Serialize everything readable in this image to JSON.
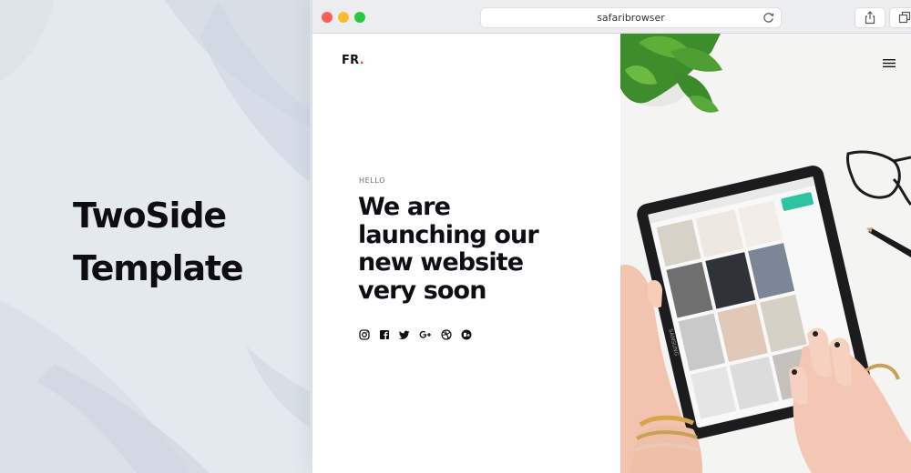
{
  "promo": {
    "title_line1": "TwoSide",
    "title_line2": "Template"
  },
  "browser": {
    "address": "safaribrowser"
  },
  "site": {
    "logo_text": "FR",
    "logo_dot": ".",
    "eyebrow": "HELLO",
    "headline": [
      "We are",
      "launching our",
      "new website",
      "very soon"
    ],
    "socials": [
      "instagram-icon",
      "facebook-icon",
      "twitter-icon",
      "google-plus-icon",
      "dribbble-icon",
      "behance-icon"
    ]
  },
  "hero_image": {
    "device_brand": "SAMSUNG"
  },
  "colors": {
    "accent": "#f2443b",
    "text_dark": "#0e0e14",
    "background": "#e4e9ef"
  }
}
